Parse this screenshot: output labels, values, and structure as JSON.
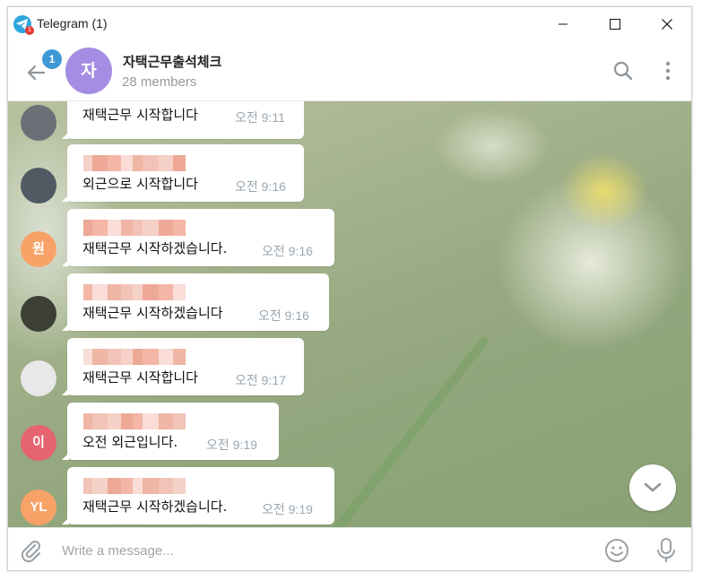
{
  "window": {
    "title": "Telegram (1)",
    "logo_badge": "1"
  },
  "header": {
    "unread_count": "1",
    "avatar_letter": "자",
    "chat_title": "자택근무출석체크",
    "members": "28 members"
  },
  "messages": [
    {
      "avatar_type": "photo",
      "avatar_label": "",
      "avatar_color": "#6b6f76",
      "text": "재택근무 시작합니다",
      "time": "오전 9:11",
      "sender_visible": false
    },
    {
      "avatar_type": "photo",
      "avatar_label": "",
      "avatar_color": "#4f5a63",
      "text": "외근으로 시작합니다",
      "time": "오전 9:16",
      "sender_visible": true
    },
    {
      "avatar_type": "initial",
      "avatar_label": "원",
      "avatar_color": "#f8a268",
      "text": "재택근무 시작하겠습니다.",
      "time": "오전 9:16",
      "sender_visible": true
    },
    {
      "avatar_type": "photo",
      "avatar_label": "",
      "avatar_color": "#3b3f36",
      "text": "재택근무 시작하겠습니다",
      "time": "오전 9:16",
      "sender_visible": true
    },
    {
      "avatar_type": "photo",
      "avatar_label": "",
      "avatar_color": "#e8e8e8",
      "text": "재택근무 시작합니다",
      "time": "오전 9:17",
      "sender_visible": true
    },
    {
      "avatar_type": "initial",
      "avatar_label": "이",
      "avatar_color": "#e5646f",
      "text": "오전 외근입니다.",
      "time": "오전 9:19",
      "sender_visible": true
    },
    {
      "avatar_type": "initial",
      "avatar_label": "YL",
      "avatar_color": "#f8a268",
      "text": "재택근무 시작하겠습니다.",
      "time": "오전 9:19",
      "sender_visible": true
    }
  ],
  "composer": {
    "placeholder": "Write a message..."
  },
  "colors": {
    "accent": "#3e98d6",
    "group_avatar": "#a48de2",
    "time_text": "#9aa7b1",
    "redacted_name": "#f4b6a6"
  },
  "icons": {
    "logo": "telegram-logo-icon",
    "back": "back-arrow-icon",
    "search": "search-icon",
    "more": "more-vertical-icon",
    "scroll_down": "chevron-down-icon",
    "attach": "paperclip-icon",
    "emoji": "emoji-icon",
    "mic": "microphone-icon"
  }
}
